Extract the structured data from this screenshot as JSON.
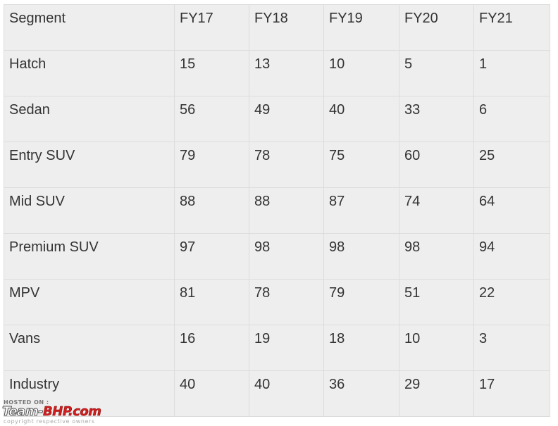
{
  "table": {
    "headers": [
      "Segment",
      "FY17",
      "FY18",
      "FY19",
      "FY20",
      "FY21"
    ],
    "rows": [
      [
        "Hatch",
        "15",
        "13",
        "10",
        "5",
        "1"
      ],
      [
        "Sedan",
        "56",
        "49",
        "40",
        "33",
        "6"
      ],
      [
        "Entry SUV",
        "79",
        "78",
        "75",
        "60",
        "25"
      ],
      [
        "Mid SUV",
        "88",
        "88",
        "87",
        "74",
        "64"
      ],
      [
        "Premium SUV",
        "97",
        "98",
        "98",
        "98",
        "94"
      ],
      [
        "MPV",
        "81",
        "78",
        "79",
        "51",
        "22"
      ],
      [
        "Vans",
        "16",
        "19",
        "18",
        "10",
        "3"
      ],
      [
        "Industry",
        "40",
        "40",
        "36",
        "29",
        "17"
      ]
    ]
  },
  "watermark": {
    "hosted_on": "HOSTED ON :",
    "brand_part1": "Team-",
    "brand_part2": "BHP.com",
    "copyright": "copyright respective owners"
  }
}
